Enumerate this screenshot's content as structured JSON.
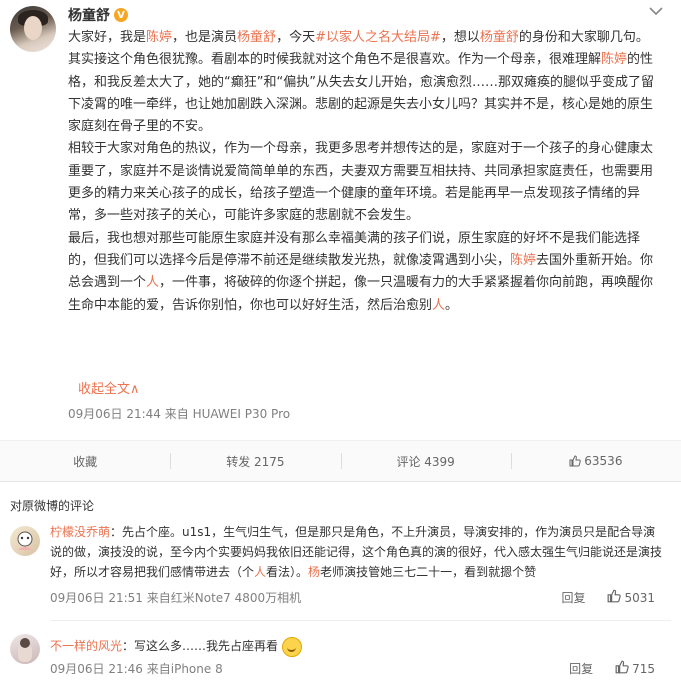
{
  "post": {
    "username": "杨童舒",
    "verified_badge": "V",
    "paragraphs": [
      [
        {
          "t": "大家好，我是"
        },
        {
          "t": "陈婷",
          "hl": true
        },
        {
          "t": "，也是演员"
        },
        {
          "t": "杨童舒",
          "hl": true
        },
        {
          "t": "，今天"
        },
        {
          "t": "#以家人之名大结局#",
          "hl": true
        },
        {
          "t": "，想以"
        },
        {
          "t": "杨童舒",
          "hl": true
        },
        {
          "t": "的身份和大家聊几句。"
        }
      ],
      [
        {
          "t": "其实接这个角色很犹豫。看剧本的时候我就对这个角色不是很喜欢。作为一个母亲，很难理解"
        },
        {
          "t": "陈婷",
          "hl": true
        },
        {
          "t": "的性格，和我反差太大了，她的“癫狂”和“偏执”从失去女儿开始，愈演愈烈……那双瘫痪的腿似乎变成了留下凌霄的唯一牵绊，也让她加剧跌入深渊。悲剧的起源是失去小女儿吗？其实并不是，核心是她的原生家庭刻在骨子里的不安。"
        }
      ],
      [
        {
          "t": "相较于大家对角色的热议，作为一个母亲，我更多思考并想传达的是，家庭对于一个孩子的身心健康太重要了，家庭并不是谈情说爱简简单单的东西，夫妻双方需要互相扶持、共同承担家庭责任，也需要用更多的精力来关心孩子的成长，给孩子塑造一个健康的童年环境。若是能再早一点发现孩子情绪的异常，多一些对孩子的关心，可能许多家庭的悲剧就不会发生。"
        }
      ],
      [
        {
          "t": "最后，我也想对那些可能原生家庭并没有那么幸福美满的孩子们说，原生家庭的好坏不是我们能选择的，但我们可以选择今后是停滞不前还是继续散发光热，就像凌霄遇到小尖，"
        },
        {
          "t": "陈婷",
          "hl": true
        },
        {
          "t": "去国外重新开始。你总会遇到一个"
        },
        {
          "t": "人",
          "hl": true
        },
        {
          "t": "，一件事，将破碎的你逐个拼起，像一只温暖有力的大手紧紧握着你向前跑，再唤醒你生命中本能的爱，告诉你别怕，你也可以好好生活，然后治愈别"
        },
        {
          "t": "人",
          "hl": true
        },
        {
          "t": "。"
        }
      ]
    ],
    "collapse_label": "收起全文∧",
    "meta": "09月06日 21:44  来自 HUAWEI P30 Pro"
  },
  "actions": {
    "favorite": "收藏",
    "repost": "转发 2175",
    "comment": "评论 4399",
    "like": "63536"
  },
  "comments_header": "对原微博的评论",
  "comments": [
    {
      "name": "柠檬没乔萌",
      "segments": [
        {
          "t": "：先占个座。u1s1，生气归生气，但是那只是角色，不上升演员，导演安排的，作为演员只是配合导演说的做，演技没的说，至今内个实要妈妈我依旧还能记得，这个角色真的演的很好，代入感太强生气归能说还是演技好，所以才容易把我们感情带进去（个"
        },
        {
          "t": "人",
          "hl": true
        },
        {
          "t": "看法）。"
        },
        {
          "t": "杨",
          "hl": true
        },
        {
          "t": "老师演技管她三七二十一，看到就摁个赞"
        }
      ],
      "meta": "09月06日 21:51  来自红米Note7 4800万相机",
      "reply": "回复",
      "likes": "5031"
    },
    {
      "name": "不一样的风光",
      "segments": [
        {
          "t": "：写这么多……我先占座再看"
        }
      ],
      "meta": "09月06日 21:46  来自iPhone 8",
      "reply": "回复",
      "likes": "715"
    }
  ],
  "colors": {
    "accent": "#eb7350",
    "meta": "#808080",
    "text": "#333333"
  }
}
